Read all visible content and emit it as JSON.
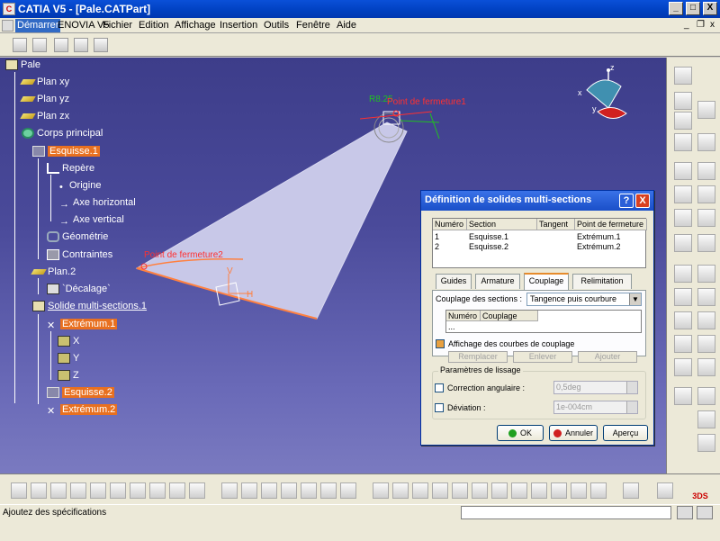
{
  "window": {
    "title": "CATIA V5 - [Pale.CATPart]",
    "min_label": "_",
    "max_label": "□",
    "close_label": "X"
  },
  "menu": {
    "items": [
      "Démarrer",
      "ENOVIA V5",
      "Fichier",
      "Edition",
      "Affichage",
      "Insertion",
      "Outils",
      "Fenêtre",
      "Aide"
    ],
    "mdi_min": "_",
    "mdi_restore": "❐",
    "mdi_close": "x"
  },
  "tree": {
    "root": "Pale",
    "plan_xy": "Plan xy",
    "plan_yz": "Plan yz",
    "plan_zx": "Plan zx",
    "body": "Corps principal",
    "sketch1": "Esquisse.1",
    "repere": "Repère",
    "origine": "Origine",
    "axe_h": "Axe horizontal",
    "axe_v": "Axe vertical",
    "geometrie": "Géométrie",
    "contraintes": "Contraintes",
    "plan2": "Plan.2",
    "decalage": "`Décalage`",
    "solid": "Solide multi-sections.1",
    "extremum1": "Extrémum.1",
    "x": "X",
    "y": "Y",
    "z": "Z",
    "sketch2": "Esquisse.2",
    "extremum2": "Extrémum.2"
  },
  "viewport": {
    "label_fermeture1": "Point de fermeture1",
    "label_fermeture2": "Point de fermeture2",
    "label_r": "R8.25",
    "label_h": "H",
    "label_v": "V",
    "compass_z": "z",
    "compass_x": "x",
    "compass_y": "y"
  },
  "dialog": {
    "title": "Définition de solides multi-sections",
    "help": "?",
    "close": "X",
    "columns": [
      "Numéro",
      "Section",
      "Tangent",
      "Point de fermeture"
    ],
    "rows": [
      {
        "num": "1",
        "section": "Esquisse.1",
        "tangent": "",
        "point": "Extrémum.1"
      },
      {
        "num": "2",
        "section": "Esquisse.2",
        "tangent": "",
        "point": "Extrémum.2"
      }
    ],
    "tabs": [
      "Guides",
      "Armature",
      "Couplage",
      "Relimitation"
    ],
    "active_tab": 2,
    "coupling_label": "Couplage des sections :",
    "coupling_value": "Tangence puis courbure",
    "sub_columns": [
      "Numéro",
      "Couplage"
    ],
    "sub_row": "...",
    "show_curves_label": "Affichage des courbes de couplage",
    "show_curves_checked": true,
    "actions": [
      "Remplacer",
      "Enlever",
      "Ajouter"
    ],
    "smoothing_title": "Paramètres de lissage",
    "angular_label": "Correction angulaire :",
    "angular_value": "0,5deg",
    "deviation_label": "Déviation :",
    "deviation_value": "1e-004cm",
    "ok": "OK",
    "cancel": "Annuler",
    "preview": "Aperçu"
  },
  "status": {
    "message": "Ajoutez des spécifications"
  },
  "colors": {
    "selection": "#e87020",
    "viewport_top": "#3d3d8a",
    "viewport_bottom": "#7a7ac0",
    "dialog_title": "#1a4fc8",
    "geometry_red": "#ff3030",
    "geometry_green": "#20c020"
  }
}
